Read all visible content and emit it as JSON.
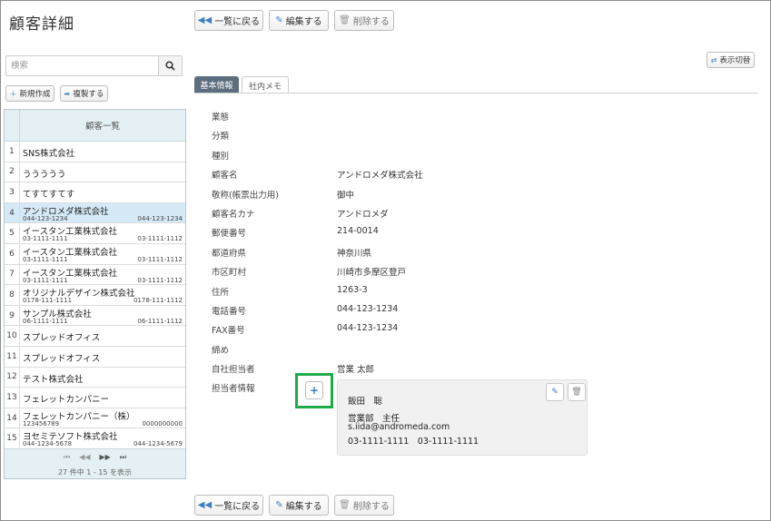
{
  "page": {
    "title": "顧客詳細"
  },
  "toolbar": {
    "back_label": "一覧に戻る",
    "edit_label": "編集する",
    "delete_label": "削除する"
  },
  "search": {
    "placeholder": "検索",
    "value": ""
  },
  "list_actions": {
    "new_label": "新規作成",
    "copy_label": "複製する"
  },
  "customer_list": {
    "header": "顧客一覧",
    "rows": [
      {
        "num": "1",
        "name": "SNS株式会社",
        "tel1": "",
        "tel2": ""
      },
      {
        "num": "2",
        "name": "ううううう",
        "tel1": "",
        "tel2": ""
      },
      {
        "num": "3",
        "name": "てすてすてす",
        "tel1": "",
        "tel2": ""
      },
      {
        "num": "4",
        "name": "アンドロメダ株式会社",
        "tel1": "044-123-1234",
        "tel2": "044-123-1234",
        "selected": true
      },
      {
        "num": "5",
        "name": "イースタン工業株式会社",
        "tel1": "03-1111-1111",
        "tel2": "03-1111-1112"
      },
      {
        "num": "6",
        "name": "イースタン工業株式会社",
        "tel1": "03-1111-1111",
        "tel2": "03-1111-1112"
      },
      {
        "num": "7",
        "name": "イースタン工業株式会社",
        "tel1": "03-1111-1111",
        "tel2": "03-1111-1112"
      },
      {
        "num": "8",
        "name": "オリジナルデザイン株式会社",
        "tel1": "0178-111-1111",
        "tel2": "0178-111-1112"
      },
      {
        "num": "9",
        "name": "サンプル株式会社",
        "tel1": "06-1111-1111",
        "tel2": "06-1111-1112"
      },
      {
        "num": "10",
        "name": "スプレッドオフィス",
        "tel1": "",
        "tel2": ""
      },
      {
        "num": "11",
        "name": "スプレッドオフィス",
        "tel1": "",
        "tel2": ""
      },
      {
        "num": "12",
        "name": "テスト株式会社",
        "tel1": "",
        "tel2": ""
      },
      {
        "num": "13",
        "name": "フェレットカンパニー",
        "tel1": "",
        "tel2": ""
      },
      {
        "num": "14",
        "name": "フェレットカンパニー（株）",
        "tel1": "123456789",
        "tel2": "0000000000"
      },
      {
        "num": "15",
        "name": "ヨセミテソフト株式会社",
        "tel1": "044-1234-5678",
        "tel2": "044-1234-5679"
      }
    ],
    "pager_info": "27 件中 1 - 15 を表示"
  },
  "display_toggle_label": "表示切替",
  "tabs": {
    "basic": "基本情報",
    "memo": "社内メモ"
  },
  "fields": [
    {
      "label": "業態",
      "value": ""
    },
    {
      "label": "分類",
      "value": ""
    },
    {
      "label": "種別",
      "value": ""
    },
    {
      "label": "顧客名",
      "value": "アンドロメダ株式会社"
    },
    {
      "label": "敬称(帳票出力用)",
      "value": "御中"
    },
    {
      "label": "顧客名カナ",
      "value": "アンドロメダ"
    },
    {
      "label": "郵便番号",
      "value": "214-0014"
    },
    {
      "label": "都道府県",
      "value": "神奈川県"
    },
    {
      "label": "市区町村",
      "value": "川崎市多摩区登戸"
    },
    {
      "label": "住所",
      "value": "1263-3"
    },
    {
      "label": "電話番号",
      "value": "044-123-1234"
    },
    {
      "label": "FAX番号",
      "value": "044-123-1234"
    },
    {
      "label": "締め",
      "value": ""
    },
    {
      "label": "自社担当者",
      "value": "営業 太郎"
    }
  ],
  "contact": {
    "label": "担当者情報",
    "add_symbol": "+",
    "name": "飯田　聡",
    "dept": "営業部　主任",
    "email": "s.iida@andromeda.com",
    "phones": "03-1111-1111　03-1111-1111"
  },
  "colors": {
    "accent": "#3d7fc1",
    "highlight": "#1faa4a",
    "tab_active": "#5d6e7e",
    "list_header": "#e4f0f4",
    "selected_row": "#d5e9f7"
  }
}
